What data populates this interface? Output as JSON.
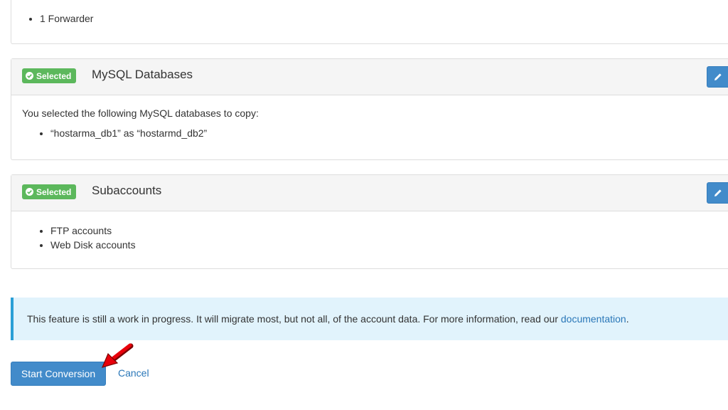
{
  "top_section": {
    "items": [
      "1 Forwarder"
    ]
  },
  "mysql_section": {
    "badge": "Selected",
    "title": "MySQL Databases",
    "intro": "You selected the following MySQL databases to copy:",
    "items": [
      "“hostarma_db1” as “hostarmd_db2”"
    ]
  },
  "subaccounts_section": {
    "badge": "Selected",
    "title": "Subaccounts",
    "items": [
      "FTP accounts",
      "Web Disk accounts"
    ]
  },
  "alert": {
    "text": "This feature is still a work in progress. It will migrate most, but not all, of the account data. For more information, read our ",
    "link": "documentation",
    "suffix": "."
  },
  "actions": {
    "start_label": "Start Conversion",
    "cancel_label": "Cancel"
  },
  "colors": {
    "primary": "#428bca",
    "success": "#5cb85c",
    "info_bg": "#e1f3fc",
    "info_border": "#2a9fd6",
    "annotation_arrow": "#e8000b"
  },
  "icons": {
    "badge": "check-circle-icon",
    "edit": "pencil-icon",
    "annotation": "red-arrow-icon"
  }
}
